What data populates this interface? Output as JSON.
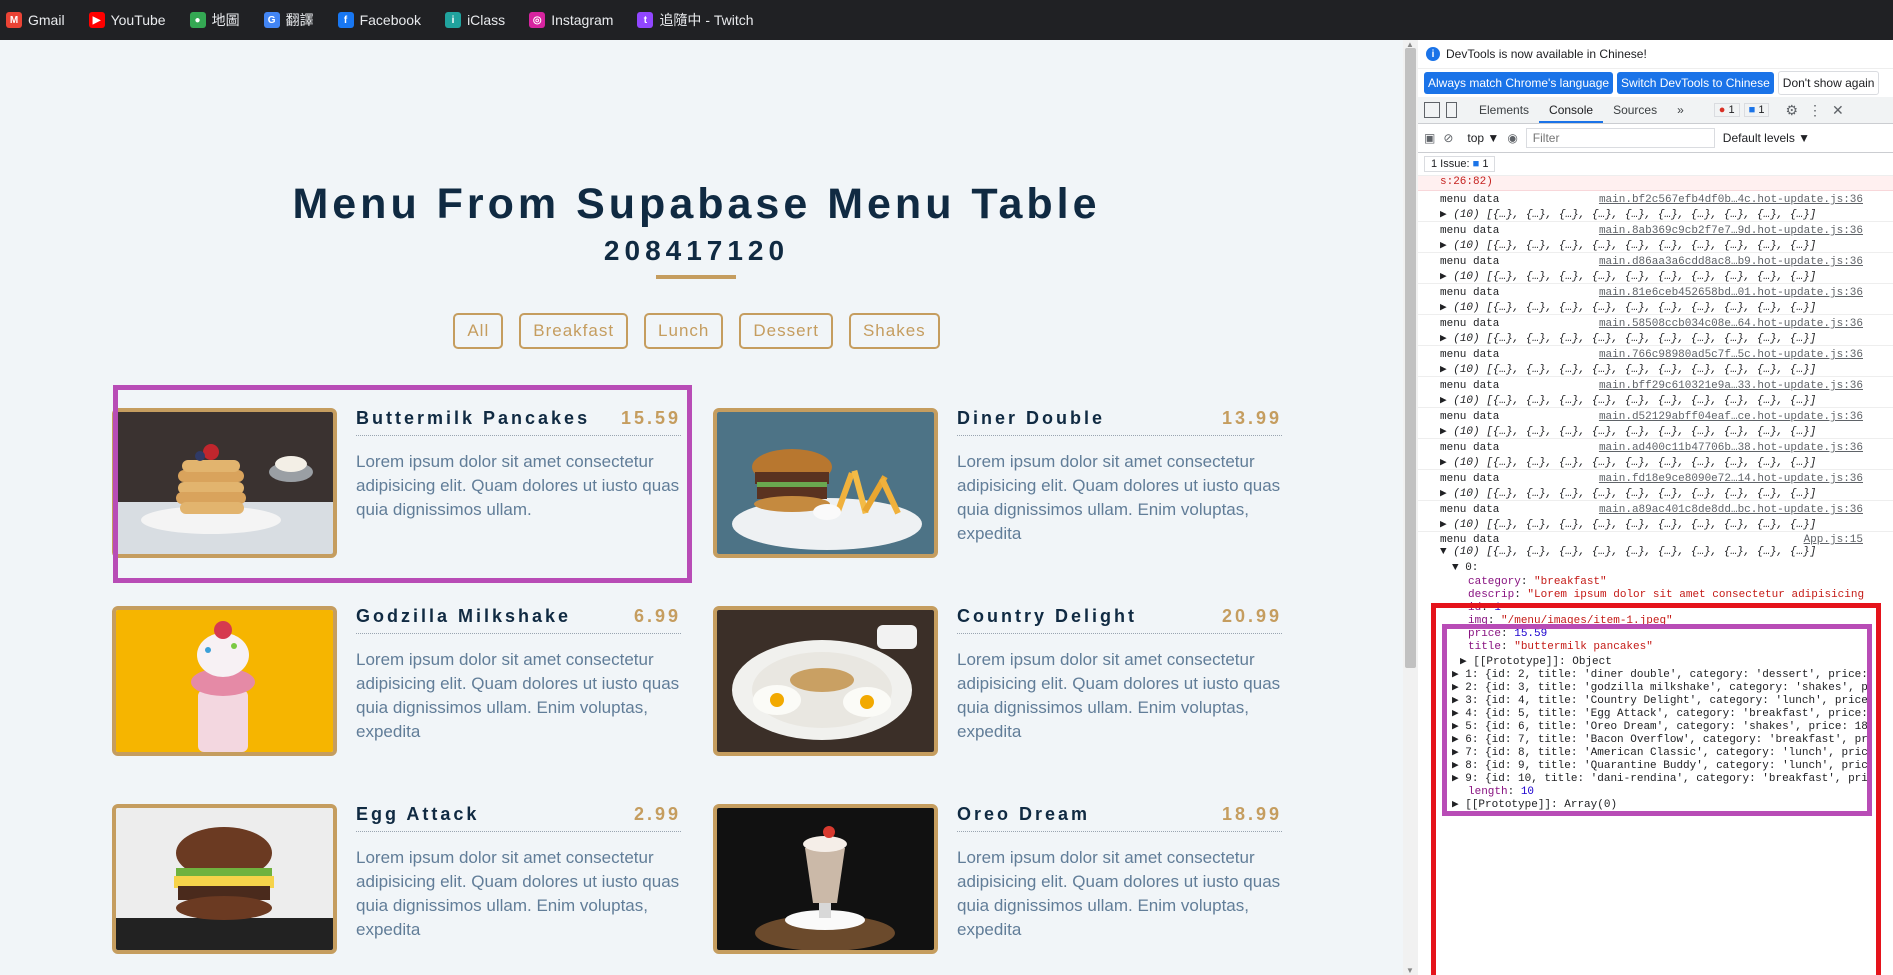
{
  "bookmarks": [
    {
      "label": "Gmail",
      "icon": "gmail-icon",
      "color": "#ea4335",
      "glyph": "M"
    },
    {
      "label": "YouTube",
      "icon": "youtube-icon",
      "color": "#ff0000",
      "glyph": "▶"
    },
    {
      "label": "地圖",
      "icon": "maps-icon",
      "color": "#34a853",
      "glyph": "●"
    },
    {
      "label": "翻譯",
      "icon": "translate-icon",
      "color": "#4285f4",
      "glyph": "G"
    },
    {
      "label": "Facebook",
      "icon": "facebook-icon",
      "color": "#1877f2",
      "glyph": "f"
    },
    {
      "label": "iClass",
      "icon": "iclass-icon",
      "color": "#20a39e",
      "glyph": "i"
    },
    {
      "label": "Instagram",
      "icon": "instagram-icon",
      "color": "#d6249f",
      "glyph": "◎"
    },
    {
      "label": "追隨中 - Twitch",
      "icon": "twitch-icon",
      "color": "#9146ff",
      "glyph": "t"
    }
  ],
  "page": {
    "title": "Menu From Supabase Menu Table",
    "subtitle": "208417120",
    "filters": [
      "All",
      "Breakfast",
      "Lunch",
      "Dessert",
      "Shakes"
    ],
    "accent_color": "#c59d5f",
    "items": [
      {
        "name": "Buttermilk Pancakes",
        "price": "15.59",
        "desc": "Lorem ipsum dolor sit amet consectetur adipisicing elit. Quam dolores ut iusto quas quia dignissimos ullam.",
        "img": "pancakes"
      },
      {
        "name": "Diner Double",
        "price": "13.99",
        "desc": "Lorem ipsum dolor sit amet consectetur adipisicing elit. Quam dolores ut iusto quas quia dignissimos ullam. Enim voluptas, expedita",
        "img": "burger"
      },
      {
        "name": "Godzilla Milkshake",
        "price": "6.99",
        "desc": "Lorem ipsum dolor sit amet consectetur adipisicing elit. Quam dolores ut iusto quas quia dignissimos ullam. Enim voluptas, expedita",
        "img": "milkshake"
      },
      {
        "name": "Country Delight",
        "price": "20.99",
        "desc": "Lorem ipsum dolor sit amet consectetur adipisicing elit. Quam dolores ut iusto quas quia dignissimos ullam. Enim voluptas, expedita",
        "img": "plate"
      },
      {
        "name": "Egg Attack",
        "price": "2.99",
        "desc": "Lorem ipsum dolor sit amet consectetur adipisicing elit. Quam dolores ut iusto quas quia dignissimos ullam. Enim voluptas, expedita",
        "img": "eggburger"
      },
      {
        "name": "Oreo Dream",
        "price": "18.99",
        "desc": "Lorem ipsum dolor sit amet consectetur adipisicing elit. Quam dolores ut iusto quas quia dignissimos ullam. Enim voluptas, expedita",
        "img": "oreo"
      }
    ]
  },
  "devtools": {
    "banner": "DevTools is now available in Chinese!",
    "buttons": [
      "Always match Chrome's language",
      "Switch DevTools to Chinese",
      "Don't show again"
    ],
    "tabs": [
      "Elements",
      "Console",
      "Sources",
      "»"
    ],
    "error_count": "1",
    "message_count": "1",
    "context": "top ▼",
    "filter_placeholder": "Filter",
    "levels": "Default levels ▼",
    "issues": "1 Issue:",
    "issues_count": "1",
    "error_line": "s:26:82)",
    "logs": [
      {
        "label": "menu data",
        "src": "main.bf2c567efb4df0b…4c.hot-update.js:36",
        "arr": "▶ (10) [{…}, {…}, {…}, {…}, {…}, {…}, {…}, {…}, {…}, {…}]"
      },
      {
        "label": "menu data",
        "src": "main.8ab369c9cb2f7e7…9d.hot-update.js:36",
        "arr": "▶ (10) [{…}, {…}, {…}, {…}, {…}, {…}, {…}, {…}, {…}, {…}]"
      },
      {
        "label": "menu data",
        "src": "main.d86aa3a6cdd8ac8…b9.hot-update.js:36",
        "arr": "▶ (10) [{…}, {…}, {…}, {…}, {…}, {…}, {…}, {…}, {…}, {…}]"
      },
      {
        "label": "menu data",
        "src": "main.81e6ceb452658bd…01.hot-update.js:36",
        "arr": "▶ (10) [{…}, {…}, {…}, {…}, {…}, {…}, {…}, {…}, {…}, {…}]"
      },
      {
        "label": "menu data",
        "src": "main.58508ccb034c08e…64.hot-update.js:36",
        "arr": "▶ (10) [{…}, {…}, {…}, {…}, {…}, {…}, {…}, {…}, {…}, {…}]"
      },
      {
        "label": "menu data",
        "src": "main.766c98980ad5c7f…5c.hot-update.js:36",
        "arr": "▶ (10) [{…}, {…}, {…}, {…}, {…}, {…}, {…}, {…}, {…}, {…}]"
      },
      {
        "label": "menu data",
        "src": "main.bff29c610321e9a…33.hot-update.js:36",
        "arr": "▶ (10) [{…}, {…}, {…}, {…}, {…}, {…}, {…}, {…}, {…}, {…}]"
      },
      {
        "label": "menu data",
        "src": "main.d52129abff04eaf…ce.hot-update.js:36",
        "arr": "▶ (10) [{…}, {…}, {…}, {…}, {…}, {…}, {…}, {…}, {…}, {…}]"
      },
      {
        "label": "menu data",
        "src": "main.ad400c11b47706b…38.hot-update.js:36",
        "arr": "▶ (10) [{…}, {…}, {…}, {…}, {…}, {…}, {…}, {…}, {…}, {…}]"
      },
      {
        "label": "menu data",
        "src": "main.fd18e9ce8090e72…14.hot-update.js:36",
        "arr": "▶ (10) [{…}, {…}, {…}, {…}, {…}, {…}, {…}, {…}, {…}, {…}]"
      },
      {
        "label": "menu data",
        "src": "main.a89ac401c8de8dd…bc.hot-update.js:36",
        "arr": "▶ (10) [{…}, {…}, {…}, {…}, {…}, {…}, {…}, {…}, {…}, {…}]"
      }
    ],
    "expanded": {
      "label": "menu data",
      "src": "App.js:15",
      "arr": "▼ (10) [{…}, {…}, {…}, {…}, {…}, {…}, {…}, {…}, {…}, {…}]",
      "item0_head": "▼ 0:",
      "item0_fields": [
        {
          "k": "category",
          "v": "\"breakfast\"",
          "t": "s"
        },
        {
          "k": "descrip",
          "v": "\"Lorem ipsum dolor sit amet consectetur adipisicing",
          "t": "s"
        },
        {
          "k": "id",
          "v": "1",
          "t": "n"
        },
        {
          "k": "img",
          "v": "\"/menu/images/item-1.jpeg\"",
          "t": "s"
        },
        {
          "k": "price",
          "v": "15.59",
          "t": "n"
        },
        {
          "k": "title",
          "v": "\"buttermilk pancakes\"",
          "t": "s"
        }
      ],
      "item0_proto": "▶ [[Prototype]]: Object",
      "rows": [
        "▶ 1: {id: 2, title: 'diner double', category: 'dessert', price:",
        "▶ 2: {id: 3, title: 'godzilla milkshake', category: 'shakes', p",
        "▶ 3: {id: 4, title: 'Country Delight', category: 'lunch', price",
        "▶ 4: {id: 5, title: 'Egg Attack', category: 'breakfast', price:",
        "▶ 5: {id: 6, title: 'Oreo Dream', category: 'shakes', price: 18",
        "▶ 6: {id: 7, title: 'Bacon Overflow', category: 'breakfast', pr",
        "▶ 7: {id: 8, title: 'American Classic', category: 'lunch', pric",
        "▶ 8: {id: 9, title: 'Quarantine Buddy', category: 'lunch', pric",
        "▶ 9: {id: 10, title: 'dani-rendina', category: 'breakfast', pri"
      ],
      "length_key": "length",
      "length_val": "10",
      "proto": "▶ [[Prototype]]: Array(0)"
    }
  }
}
